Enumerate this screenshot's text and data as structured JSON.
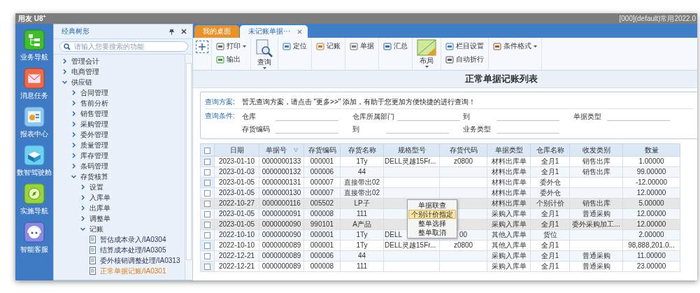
{
  "window": {
    "logo": "用友 U8$^{+}$",
    "title": "[000](default)常用2022.0"
  },
  "rail": [
    {
      "label": "业务导航",
      "kind": "nav"
    },
    {
      "label": "消息任务",
      "kind": "message"
    },
    {
      "label": "报表中心",
      "kind": "report"
    },
    {
      "label": "数智驾驶舱",
      "kind": "cockpit"
    },
    {
      "label": "实施导航",
      "kind": "compass"
    },
    {
      "label": "智能客服",
      "kind": "robot"
    }
  ],
  "tree_panel": {
    "title": "经典树形",
    "search": {
      "placeholder": "请输入您要搜索的功能"
    },
    "items": [
      {
        "label": "管理会计",
        "kind": "folder",
        "expanded": false
      },
      {
        "label": "电商管理",
        "kind": "folder",
        "expanded": false
      },
      {
        "label": "供应链",
        "kind": "folder",
        "expanded": true,
        "children": [
          {
            "label": "合同管理",
            "kind": "folder",
            "expanded": false
          },
          {
            "label": "售前分析",
            "kind": "folder",
            "expanded": false
          },
          {
            "label": "销售管理",
            "kind": "folder",
            "expanded": false
          },
          {
            "label": "采购管理",
            "kind": "folder",
            "expanded": false
          },
          {
            "label": "委外管理",
            "kind": "folder",
            "expanded": false
          },
          {
            "label": "质量管理",
            "kind": "folder",
            "expanded": false
          },
          {
            "label": "库存管理",
            "kind": "folder",
            "expanded": false
          },
          {
            "label": "条码管理",
            "kind": "folder",
            "expanded": false
          },
          {
            "label": "存货核算",
            "kind": "folder",
            "expanded": true,
            "children": [
              {
                "label": "设置",
                "kind": "folder",
                "expanded": false
              },
              {
                "label": "入库单",
                "kind": "folder",
                "expanded": false
              },
              {
                "label": "出库单",
                "kind": "folder",
                "expanded": false
              },
              {
                "label": "调整单",
                "kind": "folder",
                "expanded": false
              },
              {
                "label": "记账",
                "kind": "folder",
                "expanded": true,
                "children": [
                  {
                    "label": "暂估成本录入/IA0304",
                    "kind": "page",
                    "selected": false
                  },
                  {
                    "label": "结算成本处理/IA0305",
                    "kind": "page",
                    "selected": false
                  },
                  {
                    "label": "委外核销调整处理/IA0313",
                    "kind": "page",
                    "selected": false
                  },
                  {
                    "label": "正常单据记账/IA0301",
                    "kind": "page",
                    "selected": true
                  }
                ]
              }
            ]
          }
        ]
      }
    ]
  },
  "tabs": [
    {
      "label": "我的桌面",
      "selected": false,
      "closable": false
    },
    {
      "label": "未记账单据···",
      "selected": true,
      "closable": true
    }
  ],
  "toolbar": [
    {
      "kind": "add"
    },
    {
      "kind": "stack",
      "items": [
        {
          "label": "打印",
          "dropdown": true
        },
        {
          "label": "输出",
          "dropdown": false
        }
      ]
    },
    {
      "kind": "big",
      "label": "查询",
      "dropdown": true
    },
    {
      "kind": "stack",
      "items": [
        {
          "label": "定位",
          "dropdown": false
        }
      ]
    },
    {
      "kind": "stack",
      "items": [
        {
          "label": "记账",
          "dropdown": false
        }
      ]
    },
    {
      "kind": "stack",
      "items": [
        {
          "label": "单据",
          "dropdown": false
        }
      ]
    },
    {
      "kind": "stack",
      "items": [
        {
          "label": "汇总",
          "dropdown": false
        }
      ]
    },
    {
      "kind": "big",
      "label": "布局",
      "dropdown": true
    },
    {
      "kind": "stack",
      "items": [
        {
          "label": "栏目设置",
          "dropdown": false
        },
        {
          "label": "自动折行",
          "dropdown": false
        }
      ]
    },
    {
      "kind": "stack",
      "items": [
        {
          "label": "条件格式",
          "dropdown": true
        }
      ]
    }
  ],
  "list_title": "正常单据记账列表",
  "query": {
    "scheme_label": "查询方案:",
    "scheme_message": "暂无查询方案，请点击 \"更多>>\" 添加，有助于您更加方便快捷的进行查询！",
    "conditions_label": "查询条件:",
    "fields": [
      {
        "label": "仓库"
      },
      {
        "label": "仓库所属部门"
      },
      {
        "label": "到"
      },
      {
        "label": "单据类型"
      },
      {
        "label": "存货编码"
      },
      {
        "label": "到"
      },
      {
        "label": "业务类型"
      }
    ]
  },
  "table": {
    "all_checked": false,
    "columns": [
      {
        "label": "日期",
        "filter": false
      },
      {
        "label": "单据号",
        "filter": true
      },
      {
        "label": "存货编码",
        "filter": false
      },
      {
        "label": "存货名称",
        "filter": false
      },
      {
        "label": "规格型号",
        "filter": false
      },
      {
        "label": "存货代码",
        "filter": false
      },
      {
        "label": "单据类型",
        "filter": false
      },
      {
        "label": "仓库名称",
        "filter": false
      },
      {
        "label": "收发类别",
        "filter": false
      },
      {
        "label": "数量",
        "filter": false
      }
    ],
    "rows": [
      {
        "checked": false,
        "selected": false,
        "cells": [
          "2023-01-10",
          "0000000133",
          "000001",
          "1Ty",
          "DELL灵越15Fr...",
          "z0800",
          "材料出库单",
          "全月1",
          "销售出库",
          "1.00000"
        ]
      },
      {
        "checked": false,
        "selected": false,
        "cells": [
          "2023-01-03",
          "0000000132",
          "000006",
          "44",
          "",
          "",
          "材料出库单",
          "全月1",
          "销售出库",
          "99.00000"
        ]
      },
      {
        "checked": false,
        "selected": false,
        "cells": [
          "2023-01-05",
          "0000000131",
          "000007",
          "直接带出02",
          "",
          "",
          "材料出库单",
          "委外仓",
          "",
          "-12.00000"
        ]
      },
      {
        "checked": false,
        "selected": false,
        "cells": [
          "2023-01-05",
          "0000000130",
          "000007",
          "直接带出02",
          "",
          "",
          "材料出库单",
          "委外仓",
          "",
          "12.00000"
        ]
      },
      {
        "checked": false,
        "selected": true,
        "cells": [
          "2022-10-27",
          "0000000116",
          "005502",
          "LP子",
          "",
          "",
          "材料出库单",
          "个别计价",
          "销售出库",
          "5.00000"
        ]
      },
      {
        "checked": false,
        "selected": false,
        "cells": [
          "2023-01-05",
          "0000000091",
          "000008",
          "111",
          "",
          "",
          "采购入库单",
          "全月1",
          "普通采购",
          "12.00000"
        ]
      },
      {
        "checked": false,
        "selected": true,
        "cells": [
          "2023-01-05",
          "0000000090",
          "990101",
          "A产品",
          "",
          "",
          "采购入库单",
          "全月1",
          "委外采购加工...",
          "12.00000"
        ]
      },
      {
        "checked": false,
        "selected": false,
        "cells": [
          "2022-10-10",
          "0000000090",
          "000001",
          "1Ty",
          "DELL",
          "00",
          "其他入库单",
          "货位",
          "",
          "2.00000"
        ]
      },
      {
        "checked": false,
        "selected": false,
        "cells": [
          "2022-10-10",
          "0000000089",
          "000001",
          "1Ty",
          "DELL灵越15Fr...",
          "z0800",
          "其他入库单",
          "全月1",
          "",
          "98,888,201.0..."
        ]
      },
      {
        "checked": false,
        "selected": false,
        "cells": [
          "2022-12-21",
          "0000000089",
          "000006",
          "44",
          "",
          "",
          "采购入库单",
          "全月1",
          "普通采购",
          "11.00000"
        ]
      },
      {
        "checked": false,
        "selected": false,
        "cells": [
          "2022-12-21",
          "0000000089",
          "000008",
          "111",
          "",
          "",
          "采购入库单",
          "全月1",
          "普通采购",
          "23.00000"
        ]
      }
    ]
  },
  "context_menu": [
    {
      "label": "单据联查",
      "selected": false
    },
    {
      "label": "个别计价指定",
      "selected": true
    },
    {
      "label": "整单选择",
      "selected": false
    },
    {
      "label": "整单取消",
      "selected": false
    }
  ]
}
